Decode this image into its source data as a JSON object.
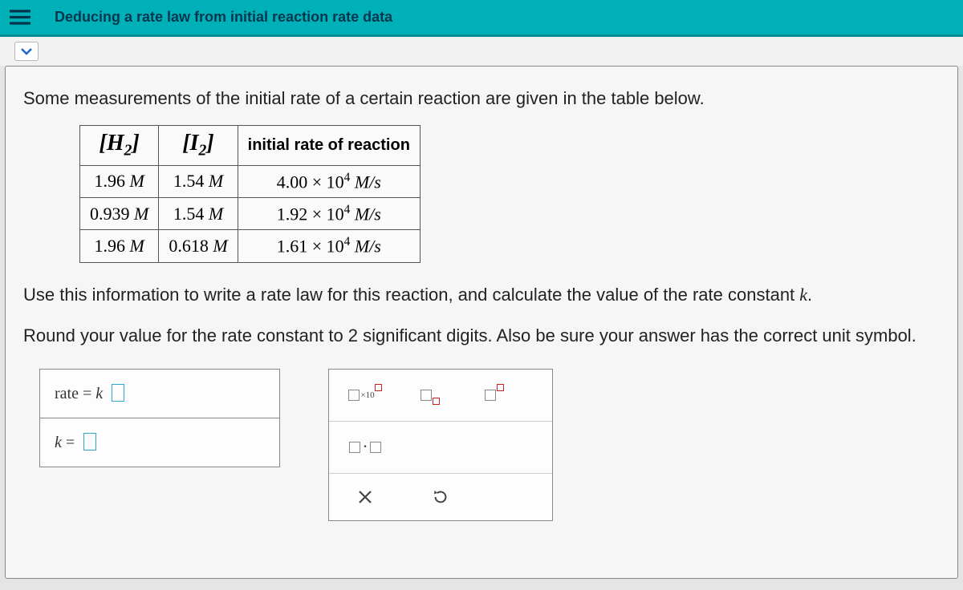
{
  "topbar": {
    "title": "Deducing a rate law from initial reaction rate data"
  },
  "intro": "Some measurements of the initial rate of a certain reaction are given in the table below.",
  "table": {
    "headers": {
      "h2": "H",
      "h2_sub": "2",
      "i2": "I",
      "i2_sub": "2",
      "rate": "initial rate of reaction"
    },
    "rows": [
      {
        "h2": "1.96",
        "i2": "1.54",
        "rate_coef": "4.00",
        "rate_exp": "4"
      },
      {
        "h2": "0.939",
        "i2": "1.54",
        "rate_coef": "1.92",
        "rate_exp": "4"
      },
      {
        "h2": "1.96",
        "i2": "0.618",
        "rate_coef": "1.61",
        "rate_exp": "4"
      }
    ],
    "unit_M": "M",
    "rate_unit": "M/s"
  },
  "prompt1": "Use this information to write a rate law for this reaction, and calculate the value of the rate constant ",
  "prompt1_k": "k",
  "prompt1_end": ".",
  "prompt2": "Round your value for the rate constant to 2 significant digits. Also be sure your answer has the correct unit symbol.",
  "answers": {
    "rate_label": "rate",
    "equals": "=",
    "k": "k",
    "k_label": "k"
  },
  "tools": {
    "x10_label": "×10",
    "dot": "·",
    "clear": "X",
    "reset": "↺"
  }
}
